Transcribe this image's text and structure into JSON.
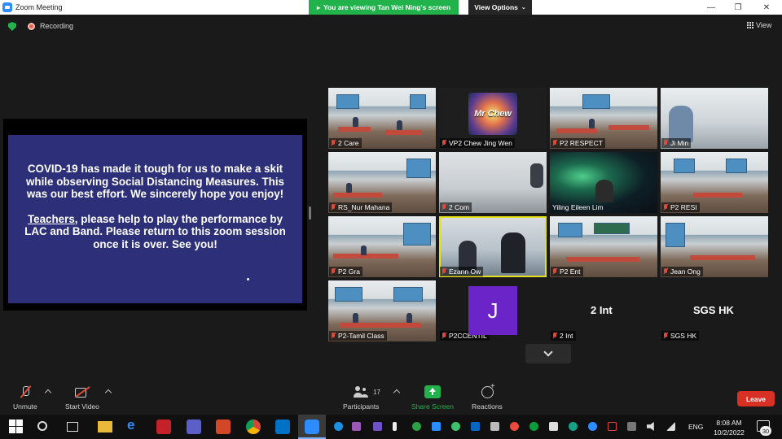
{
  "window": {
    "title": "Zoom Meeting",
    "share_banner": "You are viewing Tan Wei Ning's screen",
    "view_options": "View Options"
  },
  "status": {
    "recording_label": "Recording",
    "view_label": "View"
  },
  "slide": {
    "paragraph1": "COVID-19 has made it tough for us to make a skit while observing Social Distancing Measures. This was our best effort. We sincerely hope you enjoy!",
    "teachers_word": "Teachers",
    "paragraph2_rest": ", please help to play the performance by LAC and Band. Please return to this zoom session once it is over. See you!"
  },
  "gallery": {
    "tiles": [
      {
        "name": "2 Care"
      },
      {
        "name": "VP2 Chew Jing Wen",
        "avatar_text": "Mr Chew"
      },
      {
        "name": "P2 RESPECT"
      },
      {
        "name": "Ji Min"
      },
      {
        "name": "RS_Nur Mahana"
      },
      {
        "name": "2 Com"
      },
      {
        "name": "Yiling Eileen Lim"
      },
      {
        "name": "P2 RESI"
      },
      {
        "name": "P2 Gra"
      },
      {
        "name": "Ezann Ow"
      },
      {
        "name": "P2 Ent"
      },
      {
        "name": "Jean Ong"
      },
      {
        "name": "P2-Tamil Class"
      },
      {
        "name": "P2CCENTIL",
        "avatar_letter": "J"
      },
      {
        "name": "2 Int",
        "display_name": "2 Int"
      },
      {
        "name": "SGS HK",
        "display_name": "SGS HK"
      }
    ]
  },
  "toolbar": {
    "unmute": "Unmute",
    "start_video": "Start Video",
    "participants": "Participants",
    "participants_count": "17",
    "share_screen": "Share Screen",
    "reactions": "Reactions",
    "leave": "Leave"
  },
  "taskbar": {
    "language": "ENG",
    "time": "8:08 AM",
    "date": "10/2/2022",
    "notification_count": "30"
  },
  "colors": {
    "slide_bg": "#2d3078",
    "share_green": "#22b14c",
    "leave_red": "#d93025",
    "active_speaker": "#e6e11f",
    "avatar_purple": "#6a24c8"
  }
}
